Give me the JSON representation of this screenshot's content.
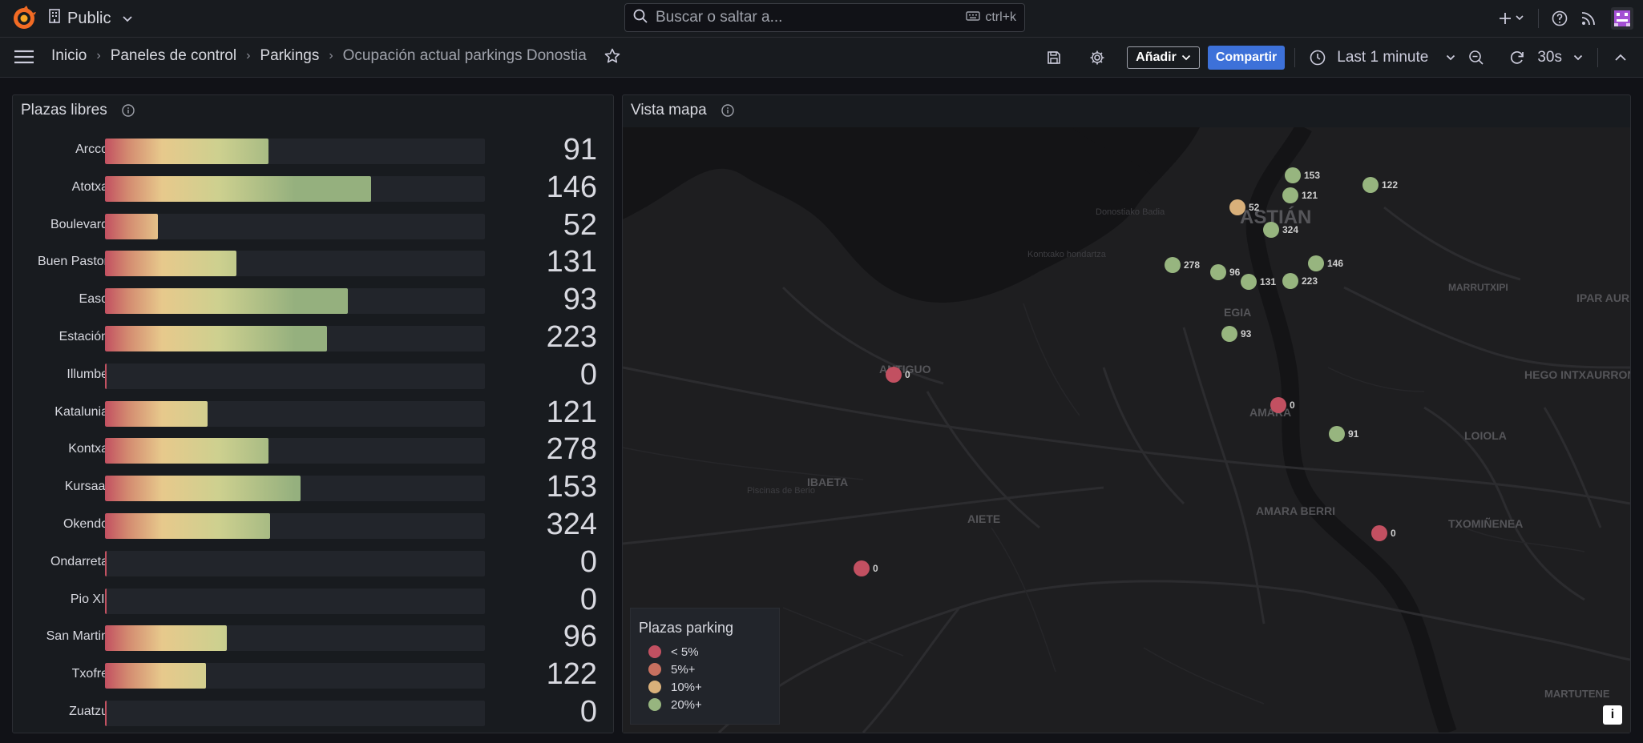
{
  "topbar": {
    "org_name": "Public",
    "search_placeholder": "Buscar o saltar a...",
    "search_shortcut": "ctrl+k"
  },
  "breadcrumbs": [
    "Inicio",
    "Paneles de control",
    "Parkings",
    "Ocupación actual parkings Donostia"
  ],
  "toolbar": {
    "add_label": "Añadir",
    "share_label": "Compartir",
    "time_range": "Last 1 minute",
    "refresh_interval": "30s"
  },
  "panel_bars": {
    "title": "Plazas libres",
    "max_value": 474,
    "rows": [
      {
        "label": "Arcco",
        "value": 91,
        "fill_fraction": 0.43
      },
      {
        "label": "Atotxa",
        "value": 146,
        "fill_fraction": 0.7
      },
      {
        "label": "Boulevard",
        "value": 52,
        "fill_fraction": 0.14
      },
      {
        "label": "Buen Pastor",
        "value": 131,
        "fill_fraction": 0.345
      },
      {
        "label": "Easo",
        "value": 93,
        "fill_fraction": 0.64
      },
      {
        "label": "Estación",
        "value": 223,
        "fill_fraction": 0.585
      },
      {
        "label": "Illumbe",
        "value": 0,
        "fill_fraction": 0
      },
      {
        "label": "Katalunia",
        "value": 121,
        "fill_fraction": 0.27
      },
      {
        "label": "Kontxa",
        "value": 278,
        "fill_fraction": 0.43
      },
      {
        "label": "Kursaal",
        "value": 153,
        "fill_fraction": 0.515
      },
      {
        "label": "Okendo",
        "value": 324,
        "fill_fraction": 0.435
      },
      {
        "label": "Ondarreta",
        "value": 0,
        "fill_fraction": 0
      },
      {
        "label": "Pio XII",
        "value": 0,
        "fill_fraction": 0
      },
      {
        "label": "San Martin",
        "value": 96,
        "fill_fraction": 0.32
      },
      {
        "label": "Txofre",
        "value": 122,
        "fill_fraction": 0.265
      },
      {
        "label": "Zuatzu",
        "value": 0,
        "fill_fraction": 0
      }
    ]
  },
  "panel_map": {
    "title": "Vista mapa",
    "map_labels": [
      "ASTIÁN",
      "EGIA",
      "MARRUTXIPI",
      "IPAR AURRONDO",
      "HEGO INTXAURRONDO",
      "LOIOLA",
      "TXOMIÑENEA",
      "MARTUTENE",
      "ANTIGUO",
      "IBAETA",
      "AIETE",
      "AMARA",
      "AMARA BERRI",
      "Donostiako Badia",
      "Kontxako hondartza",
      "Piscinas de Berio"
    ],
    "markers": [
      {
        "value": "153",
        "level": "20%+"
      },
      {
        "value": "121",
        "level": "20%+"
      },
      {
        "value": "122",
        "level": "20%+"
      },
      {
        "value": "52",
        "level": "10%+"
      },
      {
        "value": "324",
        "level": "20%+"
      },
      {
        "value": "146",
        "level": "20%+"
      },
      {
        "value": "278",
        "level": "20%+"
      },
      {
        "value": "96",
        "level": "20%+"
      },
      {
        "value": "131",
        "level": "20%+"
      },
      {
        "value": "223",
        "level": "20%+"
      },
      {
        "value": "93",
        "level": "20%+"
      },
      {
        "value": "0",
        "level": "< 5%"
      },
      {
        "value": "0",
        "level": "< 5%"
      },
      {
        "value": "91",
        "level": "20%+"
      },
      {
        "value": "0",
        "level": "< 5%"
      },
      {
        "value": "0",
        "level": "< 5%"
      }
    ],
    "legend": {
      "title": "Plazas parking",
      "items": [
        {
          "label": "< 5%",
          "color": "#c25061"
        },
        {
          "label": "5%+",
          "color": "#c8705f"
        },
        {
          "label": "10%+",
          "color": "#d9b07a"
        },
        {
          "label": "20%+",
          "color": "#97b57f"
        }
      ]
    },
    "attribution_icon": "i"
  },
  "colors": {
    "accent": "#3d71d9",
    "green": "#97b57f",
    "yellow": "#d9b07a",
    "red": "#c25061"
  }
}
